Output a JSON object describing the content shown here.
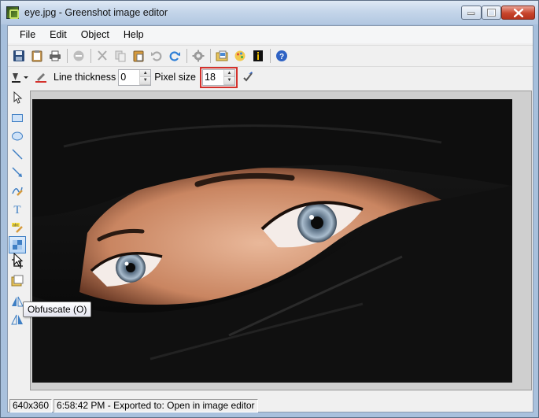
{
  "window": {
    "title": "eye.jpg - Greenshot image editor",
    "icon": "greenshot-app-icon",
    "controls": [
      "minimize",
      "maximize",
      "close"
    ]
  },
  "menu": {
    "items": [
      "File",
      "Edit",
      "Object",
      "Help"
    ]
  },
  "toolbar": {
    "icons": [
      "save-icon",
      "clipboard-icon",
      "print-icon",
      "delete-icon",
      "cut-icon",
      "copy-icon",
      "paste-icon",
      "undo-icon",
      "redo-icon",
      "settings-icon",
      "open-file-icon",
      "color-icon",
      "info-icon",
      "help-icon"
    ]
  },
  "properties": {
    "line_thickness_label": "Line thickness",
    "line_thickness_value": "0",
    "pixel_size_label": "Pixel size",
    "pixel_size_value": "18",
    "highlight_color": "#d4312c"
  },
  "tools": {
    "items": [
      "select",
      "rectangle",
      "ellipse",
      "line",
      "arrow",
      "freehand",
      "text",
      "highlight",
      "obfuscate",
      "crop",
      "image",
      "flip-horizontal",
      "flip-vertical"
    ],
    "active": "obfuscate",
    "tooltip": "Obfuscate (O)"
  },
  "status": {
    "dimensions": "640x360",
    "message": "6:58:42 PM - Exported to: Open in image editor"
  },
  "colors": {
    "accent": "#3f7fc4",
    "highlight_border": "#d4312c",
    "canvas_bg": "#cfcfcf"
  }
}
